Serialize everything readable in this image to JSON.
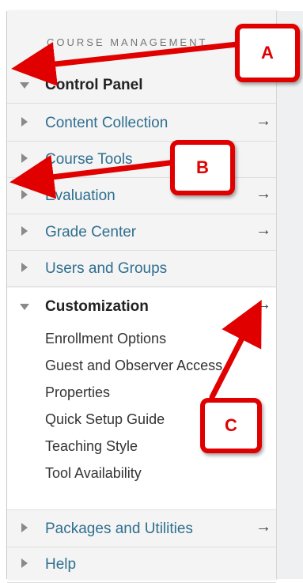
{
  "section_heading": "COURSE MANAGEMENT",
  "control_panel": "Control Panel",
  "items": {
    "content_collection": "Content Collection",
    "course_tools": "Course Tools",
    "evaluation": "Evaluation",
    "grade_center": "Grade Center",
    "users_groups": "Users and Groups",
    "customization": "Customization",
    "packages": "Packages and Utilities",
    "help": "Help"
  },
  "customization_sub": [
    "Enrollment Options",
    "Guest and Observer Access",
    "Properties",
    "Quick Setup Guide",
    "Teaching Style",
    "Tool Availability"
  ],
  "arrow_glyph": "→",
  "callouts": {
    "a": "A",
    "b": "B",
    "c": "C"
  },
  "colors": {
    "link": "#2f6f8f",
    "callout_red": "#e00000"
  }
}
